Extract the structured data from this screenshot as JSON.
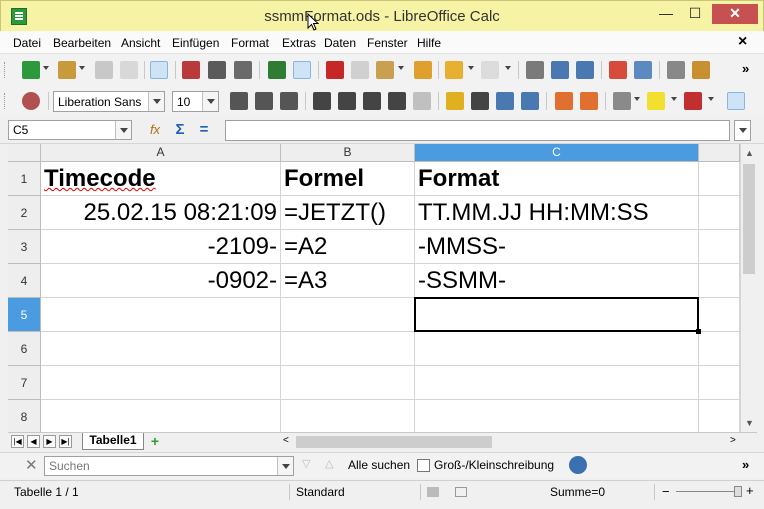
{
  "window": {
    "title": "ssmmFormat.ods - LibreOffice Calc",
    "minimize": "—",
    "maximize": "☐",
    "close": "✕"
  },
  "menubar": {
    "items": [
      {
        "label": "Datei"
      },
      {
        "label": "Bearbeiten"
      },
      {
        "label": "Ansicht"
      },
      {
        "label": "Einfügen"
      },
      {
        "label": "Format"
      },
      {
        "label": "Extras"
      },
      {
        "label": "Daten"
      },
      {
        "label": "Fenster"
      },
      {
        "label": "Hilfe"
      }
    ],
    "close_doc": "×"
  },
  "toolbar_standard": {
    "icons": [
      "new-icon",
      "open-icon",
      "save-icon",
      "email-icon",
      "edit-mode-icon",
      "export-pdf-icon",
      "print-icon",
      "print-preview-icon",
      "spellcheck-icon",
      "autospell-icon",
      "cut-icon",
      "copy-icon",
      "paste-icon",
      "clone-format-icon",
      "undo-icon",
      "redo-icon",
      "hyperlink-icon",
      "sort-asc-icon",
      "sort-desc-icon",
      "chart-icon",
      "pivot-icon",
      "stop-icon",
      "gallery-icon"
    ],
    "more": "»"
  },
  "toolbar_format": {
    "font_name": "Liberation Sans",
    "font_size": "10",
    "more": "»"
  },
  "formula_bar": {
    "cell_reference": "C5",
    "function_wizard_icon": "fx-icon",
    "sum_symbol": "Σ",
    "equals_symbol": "=",
    "formula": ""
  },
  "sheet": {
    "columns": [
      "A",
      "B",
      "C"
    ],
    "active_column": "C",
    "rows": [
      "1",
      "2",
      "3",
      "4",
      "5",
      "6",
      "7",
      "8"
    ],
    "active_row": "5",
    "cells": {
      "A1": "Timecode",
      "B1": "Formel",
      "C1": "Format",
      "A2": "25.02.15 08:21:09",
      "B2": "=JETZT()",
      "C2": "TT.MM.JJ HH:MM:SS",
      "A3": "-2109-",
      "B3": "=A2",
      "C3": "-MMSS-",
      "A4": "-0902-",
      "B4": "=A3",
      "C4": "-SSMM-"
    }
  },
  "sheet_tabs": {
    "active": "Tabelle1",
    "add_symbol": "+"
  },
  "find_toolbar": {
    "placeholder": "Suchen",
    "find_all": "Alle suchen",
    "match_case": "Groß-/Kleinschreibung",
    "more": "»"
  },
  "statusbar": {
    "sheet_info": "Tabelle 1 / 1",
    "page_style": "Standard",
    "sum": "Summe=0"
  },
  "colors": {
    "titlebar": "#f6f3a5",
    "active_header": "#4b9be0",
    "close_button": "#c75050"
  }
}
